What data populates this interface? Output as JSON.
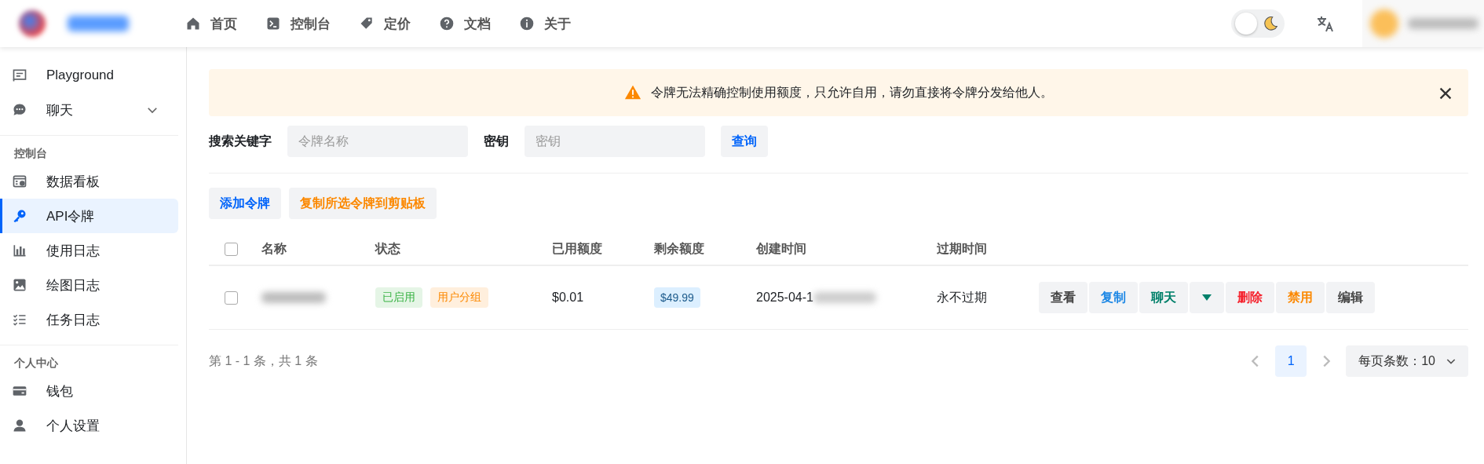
{
  "header": {
    "nav": [
      {
        "label": "首页"
      },
      {
        "label": "控制台"
      },
      {
        "label": "定价"
      },
      {
        "label": "文档"
      },
      {
        "label": "关于"
      }
    ],
    "theme_toggle": {
      "on": false
    }
  },
  "sidebar": {
    "sections": [
      {
        "items": [
          {
            "label": "Playground",
            "selected": false
          },
          {
            "label": "聊天",
            "selected": false,
            "expanded": false
          }
        ]
      },
      {
        "title": "控制台",
        "items": [
          {
            "label": "数据看板",
            "selected": false
          },
          {
            "label": "API令牌",
            "selected": true
          },
          {
            "label": "使用日志",
            "selected": false
          },
          {
            "label": "绘图日志",
            "selected": false
          },
          {
            "label": "任务日志",
            "selected": false
          }
        ]
      },
      {
        "title": "个人中心",
        "items": [
          {
            "label": "钱包",
            "selected": false
          },
          {
            "label": "个人设置",
            "selected": false
          }
        ]
      }
    ]
  },
  "alert": {
    "text": "令牌无法精确控制使用额度，只允许自用，请勿直接将令牌分发给他人。"
  },
  "search": {
    "keyword_label": "搜索关键字",
    "keyword_placeholder": "令牌名称",
    "key_label": "密钥",
    "key_placeholder": "密钥",
    "query_button": "查询"
  },
  "toolbar": [
    {
      "label": "添加令牌",
      "color": "#0064fa"
    },
    {
      "label": "复制所选令牌到剪贴板",
      "color": "#fc8800"
    }
  ],
  "table": {
    "columns": [
      "名称",
      "状态",
      "已用额度",
      "剩余额度",
      "创建时间",
      "过期时间"
    ],
    "select_all": {
      "checked": false
    },
    "rows": [
      {
        "checked": false,
        "tags": [
          {
            "label": "已启用",
            "color": "#3bb346"
          },
          {
            "label": "用户分组",
            "color": "#fc8800"
          }
        ],
        "used": "$0.01",
        "remaining": "$49.99",
        "created": "2025-04-1",
        "expires": "永不过期",
        "actions": [
          {
            "kind": "text",
            "label": "查看",
            "color": "#444444"
          },
          {
            "kind": "text",
            "label": "复制",
            "color": "#1e88e5"
          },
          {
            "kind": "text",
            "label": "聊天",
            "color": "#00806a"
          },
          {
            "kind": "dropdown",
            "color": "#00806a"
          },
          {
            "kind": "text",
            "label": "删除",
            "color": "#f5222d"
          },
          {
            "kind": "text",
            "label": "禁用",
            "color": "#fc8800"
          },
          {
            "kind": "text",
            "label": "编辑",
            "color": "#444444"
          }
        ]
      }
    ]
  },
  "pagination": {
    "summary": "第 1 - 1 条，共 1 条",
    "prev_disabled": true,
    "pages": [
      {
        "label": "1",
        "selected": true
      }
    ],
    "next_disabled": true,
    "page_size": "每页条数：10"
  }
}
